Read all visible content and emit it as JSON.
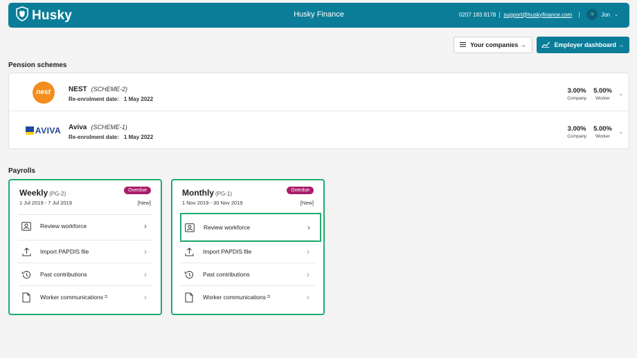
{
  "header": {
    "brand": "Husky",
    "title": "Husky Finance",
    "phone": "0207 183 8178",
    "email": "support@huskyfinance.com",
    "avatar_initials": "JE",
    "user": "Jon"
  },
  "actions": {
    "companies": "Your companies →",
    "employer": "Employer dashboard →"
  },
  "pension": {
    "heading": "Pension schemes",
    "schemes": [
      {
        "name": "NEST",
        "code": "(SCHEME-2)",
        "logo_text": "nest",
        "date_label": "Re-enrolment date:",
        "date": "1 May 2022",
        "company_rate": "3.00%",
        "company_label": "Company",
        "worker_rate": "5.00%",
        "worker_label": "Worker"
      },
      {
        "name": "Aviva",
        "code": "(SCHEME-1)",
        "logo_text": "AVIVA",
        "date_label": "Re-enrolment date:",
        "date": "1 May 2022",
        "company_rate": "3.00%",
        "company_label": "Company",
        "worker_rate": "5.00%",
        "worker_label": "Worker"
      }
    ]
  },
  "payrolls": {
    "heading": "Payrolls",
    "cards": [
      {
        "title": "Weekly",
        "code": "(PG-2)",
        "badge": "Overdue",
        "dates": "1 Jul 2019 - 7 Jul 2019",
        "status": "[New]",
        "items": [
          {
            "label": "Review workforce",
            "icon": "person-badge-icon"
          },
          {
            "label": "Import PAPDIS file",
            "icon": "upload-icon"
          },
          {
            "label": "Past contributions",
            "icon": "history-icon"
          },
          {
            "label": "Worker communications",
            "icon": "document-icon"
          }
        ]
      },
      {
        "title": "Monthly",
        "code": "(PG-1)",
        "badge": "Overdue",
        "dates": "1 Nov 2019 - 30 Nov 2019",
        "status": "[New]",
        "items": [
          {
            "label": "Review workforce",
            "icon": "person-badge-icon"
          },
          {
            "label": "Import PAPDIS file",
            "icon": "upload-icon"
          },
          {
            "label": "Past contributions",
            "icon": "history-icon"
          },
          {
            "label": "Worker communications",
            "icon": "document-icon"
          }
        ]
      }
    ]
  },
  "colors": {
    "primary": "#0b7d99",
    "highlight": "#1faa6f",
    "badge": "#a91d6c"
  }
}
